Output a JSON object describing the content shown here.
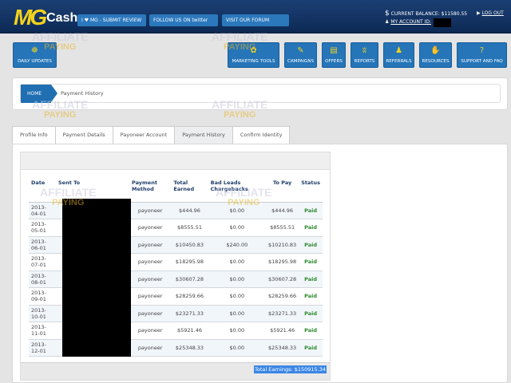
{
  "header": {
    "logo_mg": "MG",
    "logo_cash": "Cash",
    "btn_review": "I ♥ MG - SUBMIT REVIEW",
    "btn_twitter": "FOLLOW US ON twitter",
    "btn_forum": "VISIT OUR FORUM",
    "balance": "CURRENT BALANCE: $11580.55",
    "account": "MY ACCOUNT ID:",
    "logout": "LOG OUT"
  },
  "nav": [
    {
      "label": "DAILY UPDATES",
      "icon": "☸"
    },
    {
      "label": "MARKETING TOOLS",
      "icon": "✿"
    },
    {
      "label": "CAMPAIGNS",
      "icon": "✎"
    },
    {
      "label": "OFFERS",
      "icon": "▤"
    },
    {
      "label": "REPORTS",
      "icon": "ʬ"
    },
    {
      "label": "REFERRALS",
      "icon": "♟"
    },
    {
      "label": "RESOURCES",
      "icon": "✋"
    },
    {
      "label": "SUPPORT AND FAQ",
      "icon": "?"
    }
  ],
  "breadcrumb": {
    "home": "HOME",
    "current": "Payment History"
  },
  "tabs": [
    "Profile Info",
    "Payment Details",
    "Payoneer Account",
    "Payment History",
    "Confirm Identity"
  ],
  "table": {
    "headers": [
      "Date",
      "Sent To",
      "Payment Method",
      "Total Earned",
      "Bad Leads Chargebacks",
      "To Pay",
      "Status"
    ],
    "rows": [
      [
        "2013-04-01",
        "payoneer",
        "$444.96",
        "$0.00",
        "$444.96",
        "Paid"
      ],
      [
        "2013-05-01",
        "payoneer",
        "$8555.51",
        "$0.00",
        "$8555.51",
        "Paid"
      ],
      [
        "2013-06-01",
        "payoneer",
        "$10450.83",
        "$240.00",
        "$10210.83",
        "Paid"
      ],
      [
        "2013-07-01",
        "payoneer",
        "$18295.98",
        "$0.00",
        "$18295.98",
        "Paid"
      ],
      [
        "2013-08-01",
        "payoneer",
        "$30607.28",
        "$0.00",
        "$30607.28",
        "Paid"
      ],
      [
        "2013-09-01",
        "payoneer",
        "$28259.66",
        "$0.00",
        "$28259.66",
        "Paid"
      ],
      [
        "2013-10-01",
        "payoneer",
        "$23271.33",
        "$0.00",
        "$23271.33",
        "Paid"
      ],
      [
        "2013-11-01",
        "payoneer",
        "$5921.46",
        "$0.00",
        "$5921.46",
        "Paid"
      ],
      [
        "2013-12-01",
        "payoneer",
        "$25348.33",
        "$0.00",
        "$25348.33",
        "Paid"
      ]
    ]
  },
  "total": "Total Earnings: $150915.34",
  "watermark": {
    "line1": "AFFILIATE",
    "line2": "PAYING"
  }
}
